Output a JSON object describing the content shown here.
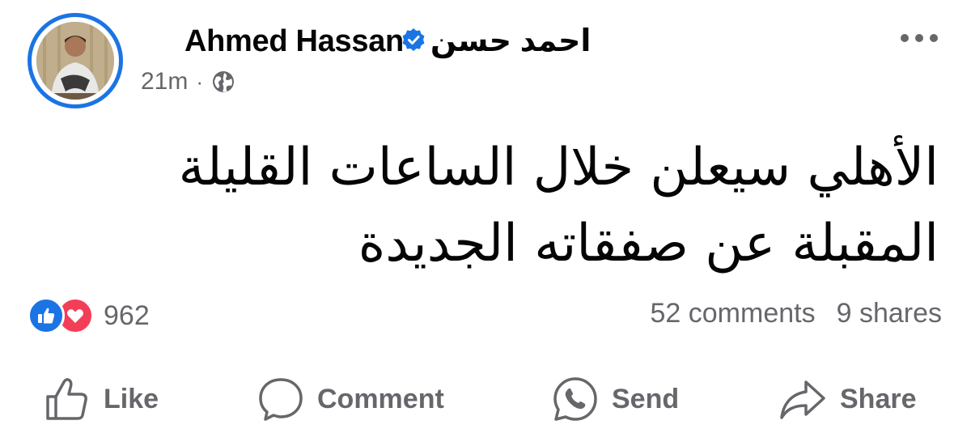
{
  "post": {
    "author": "Ahmed Hassan - احمد حسن",
    "time": "21m",
    "separator": "·",
    "visibility_icon": "globe-icon",
    "text": "الأهلي سيعلن خلال الساعات القليلة المقبلة عن صفقاته الجديدة"
  },
  "engagement": {
    "reaction_icons": [
      "like-icon",
      "love-icon"
    ],
    "reaction_count": "962",
    "comments": "52 comments",
    "shares": "9 shares"
  },
  "actions": {
    "like": "Like",
    "comment": "Comment",
    "send": "Send",
    "share": "Share"
  },
  "colors": {
    "accent": "#1b74e4",
    "love": "#f33e58",
    "muted": "#65676b",
    "text": "#050505"
  }
}
